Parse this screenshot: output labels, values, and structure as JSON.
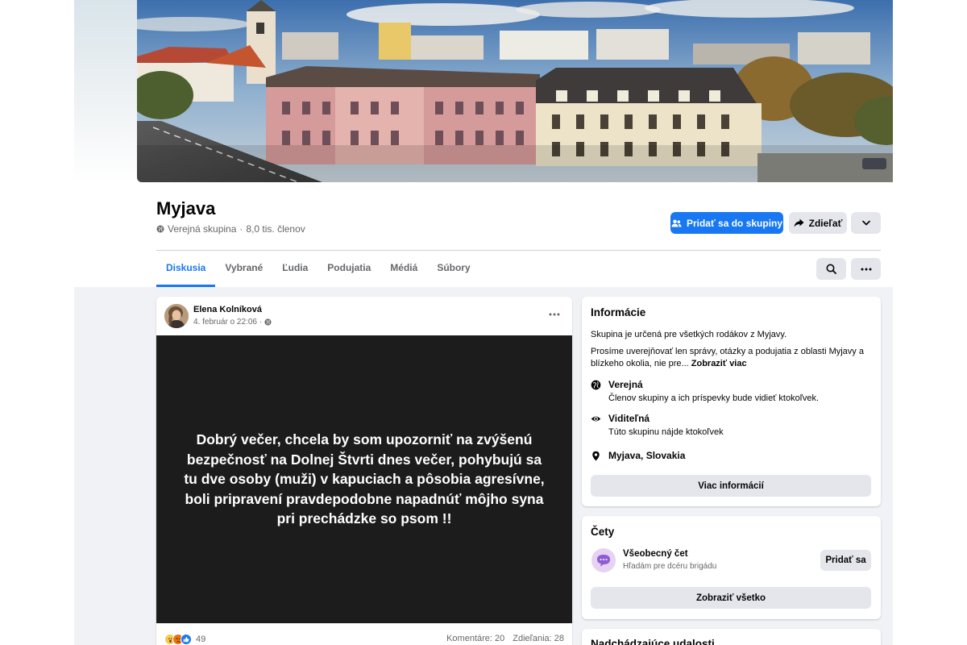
{
  "group": {
    "name": "Myjava",
    "privacy": "Verejná skupina",
    "members": "8,0 tis. členov",
    "join_label": "Pridať sa do skupiny",
    "share_label": "Zdieľať"
  },
  "tabs": [
    {
      "label": "Diskusia",
      "active": true
    },
    {
      "label": "Vybrané"
    },
    {
      "label": "Ľudia"
    },
    {
      "label": "Podujatia"
    },
    {
      "label": "Médiá"
    },
    {
      "label": "Súbory"
    }
  ],
  "post": {
    "author": "Elena Kolníková",
    "time": "4. február o 22:06",
    "text": "Dobrý večer, chcela by som upozorniť na zvýšenú bezpečnosť na Dolnej Štvrti dnes večer, pohybujú sa tu dve osoby (muži) v kapuciach a pôsobia agresívne, boli pripravení pravdepodobne napadnúť môjho syna pri prechádzke so psom !!",
    "reaction_count": "49",
    "comments": "Komentáre: 20",
    "shares": "Zdieľania: 28"
  },
  "info": {
    "title": "Informácie",
    "desc1": "Skupina je určená pre všetkých rodákov z Myjavy.",
    "desc2": "Prosíme uverejňovať len správy, otázky a podujatia z oblasti Myjavy a blízkeho okolia, nie pre...",
    "see_more": "Zobraziť viac",
    "public_title": "Verejná",
    "public_desc": "Členov skupiny a ich príspevky bude vidieť ktokoľvek.",
    "visible_title": "Viditeľná",
    "visible_desc": "Túto skupinu nájde ktokoľvek",
    "location": "Myjava, Slovakia",
    "more_info": "Viac informácií"
  },
  "chats": {
    "title": "Čety",
    "name": "Všeobecný čet",
    "subtitle": "Hľadám pre dcéru brigádu",
    "join": "Pridať sa",
    "see_all": "Zobraziť všetko"
  },
  "events": {
    "title": "Nadchádzajúce udalosti"
  },
  "colors": {
    "accent": "#1877f2",
    "button_gray": "#e4e6eb",
    "page_bg": "#f0f2f5",
    "post_bg": "#1c1c1c"
  }
}
